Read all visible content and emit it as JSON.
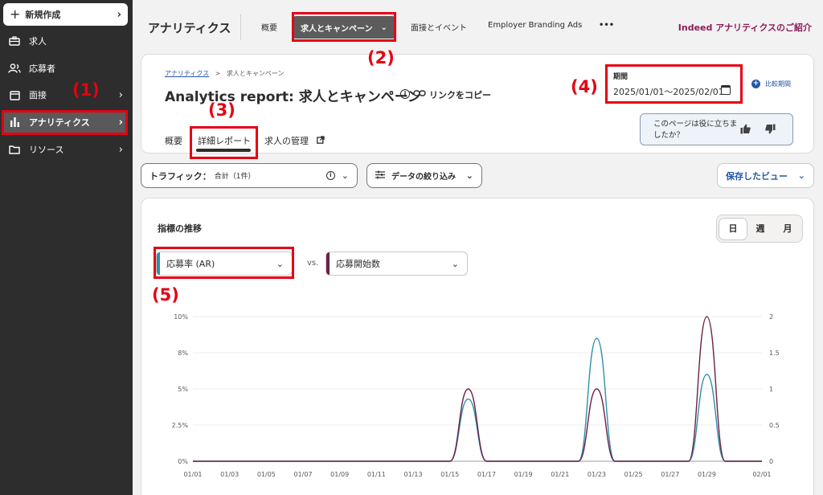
{
  "sidebar": {
    "new_label": "新規作成",
    "items": [
      {
        "label": "求人"
      },
      {
        "label": "応募者"
      },
      {
        "label": "面接"
      },
      {
        "label": "アナリティクス"
      },
      {
        "label": "リソース"
      }
    ]
  },
  "annotations": [
    "(1)",
    "(2)",
    "(3)",
    "(4)",
    "(5)"
  ],
  "topnav": {
    "title": "アナリティクス",
    "tabs": [
      "概要",
      "求人とキャンペーン",
      "面接とイベント",
      "Employer Branding Ads",
      "•••"
    ],
    "link": "Indeed アナリティクスのご紹介"
  },
  "header": {
    "breadcrumb": {
      "root": "アナリティクス",
      "sep": ">",
      "current": "求人とキャンペーン"
    },
    "title": "Analytics report: 求人とキャンペーン",
    "copy_link": "リンクをコピー",
    "subtabs": [
      "概要",
      "詳細レポート",
      "求人の管理"
    ],
    "period_label": "期間",
    "period_value": "2025/01/01〜2025/02/01",
    "compare": "比較期間",
    "feedback": "このページは役に立ちましたか？"
  },
  "filters": {
    "traffic_label": "トラフィック：",
    "traffic_value": "合計（1件）",
    "narrow": "データの絞り込み",
    "saved_view": "保存したビュー"
  },
  "chart_card": {
    "title": "指標の推移",
    "granularity": [
      "日",
      "週",
      "月"
    ],
    "metric_left": "応募率 (AR)",
    "vs": "vs.",
    "metric_right": "応募開始数"
  },
  "colors": {
    "accent_teal": "#2e8fad",
    "accent_plum": "#6e1f46",
    "brand_blue": "#2557a7",
    "sidebar_bg": "#2d2d2d",
    "highlight_red": "#e60012"
  },
  "chart_data": {
    "type": "line",
    "x": [
      "01/01",
      "01/02",
      "01/03",
      "01/04",
      "01/05",
      "01/06",
      "01/07",
      "01/08",
      "01/09",
      "01/10",
      "01/11",
      "01/12",
      "01/13",
      "01/14",
      "01/15",
      "01/16",
      "01/17",
      "01/18",
      "01/19",
      "01/20",
      "01/21",
      "01/22",
      "01/23",
      "01/24",
      "01/25",
      "01/26",
      "01/27",
      "01/28",
      "01/29",
      "01/30",
      "01/31",
      "02/01"
    ],
    "x_tick_labels": [
      "01/01",
      "01/03",
      "01/05",
      "01/07",
      "01/09",
      "01/11",
      "01/13",
      "01/15",
      "01/17",
      "01/19",
      "01/21",
      "01/23",
      "01/25",
      "01/27",
      "01/29",
      "02/01"
    ],
    "y_left": {
      "ticks": [
        "0%",
        "2.5%",
        "5%",
        "8%",
        "10%"
      ],
      "tick_values": [
        0,
        2.5,
        5,
        7.5,
        10
      ],
      "ylim": [
        0,
        10
      ]
    },
    "y_right": {
      "ticks": [
        "0",
        "0.5",
        "1",
        "1.5",
        "2"
      ],
      "tick_values": [
        0,
        0.5,
        1,
        1.5,
        2
      ],
      "ylim": [
        0,
        2
      ]
    },
    "series": [
      {
        "name": "応募率 (AR)",
        "axis": "left",
        "color": "#2e8fad",
        "values": [
          0,
          0,
          0,
          0,
          0,
          0,
          0,
          0,
          0,
          0,
          0,
          0,
          0,
          0,
          0,
          4.3,
          0,
          0,
          0,
          0,
          0,
          0,
          8.5,
          0,
          0,
          0,
          0,
          0,
          6.0,
          0,
          0,
          0
        ]
      },
      {
        "name": "応募開始数",
        "axis": "right",
        "color": "#6e1f46",
        "values": [
          0,
          0,
          0,
          0,
          0,
          0,
          0,
          0,
          0,
          0,
          0,
          0,
          0,
          0,
          0,
          1,
          0,
          0,
          0,
          0,
          0,
          0,
          1,
          0,
          0,
          0,
          0,
          0,
          2,
          0,
          0,
          0
        ]
      }
    ],
    "grid": true
  }
}
